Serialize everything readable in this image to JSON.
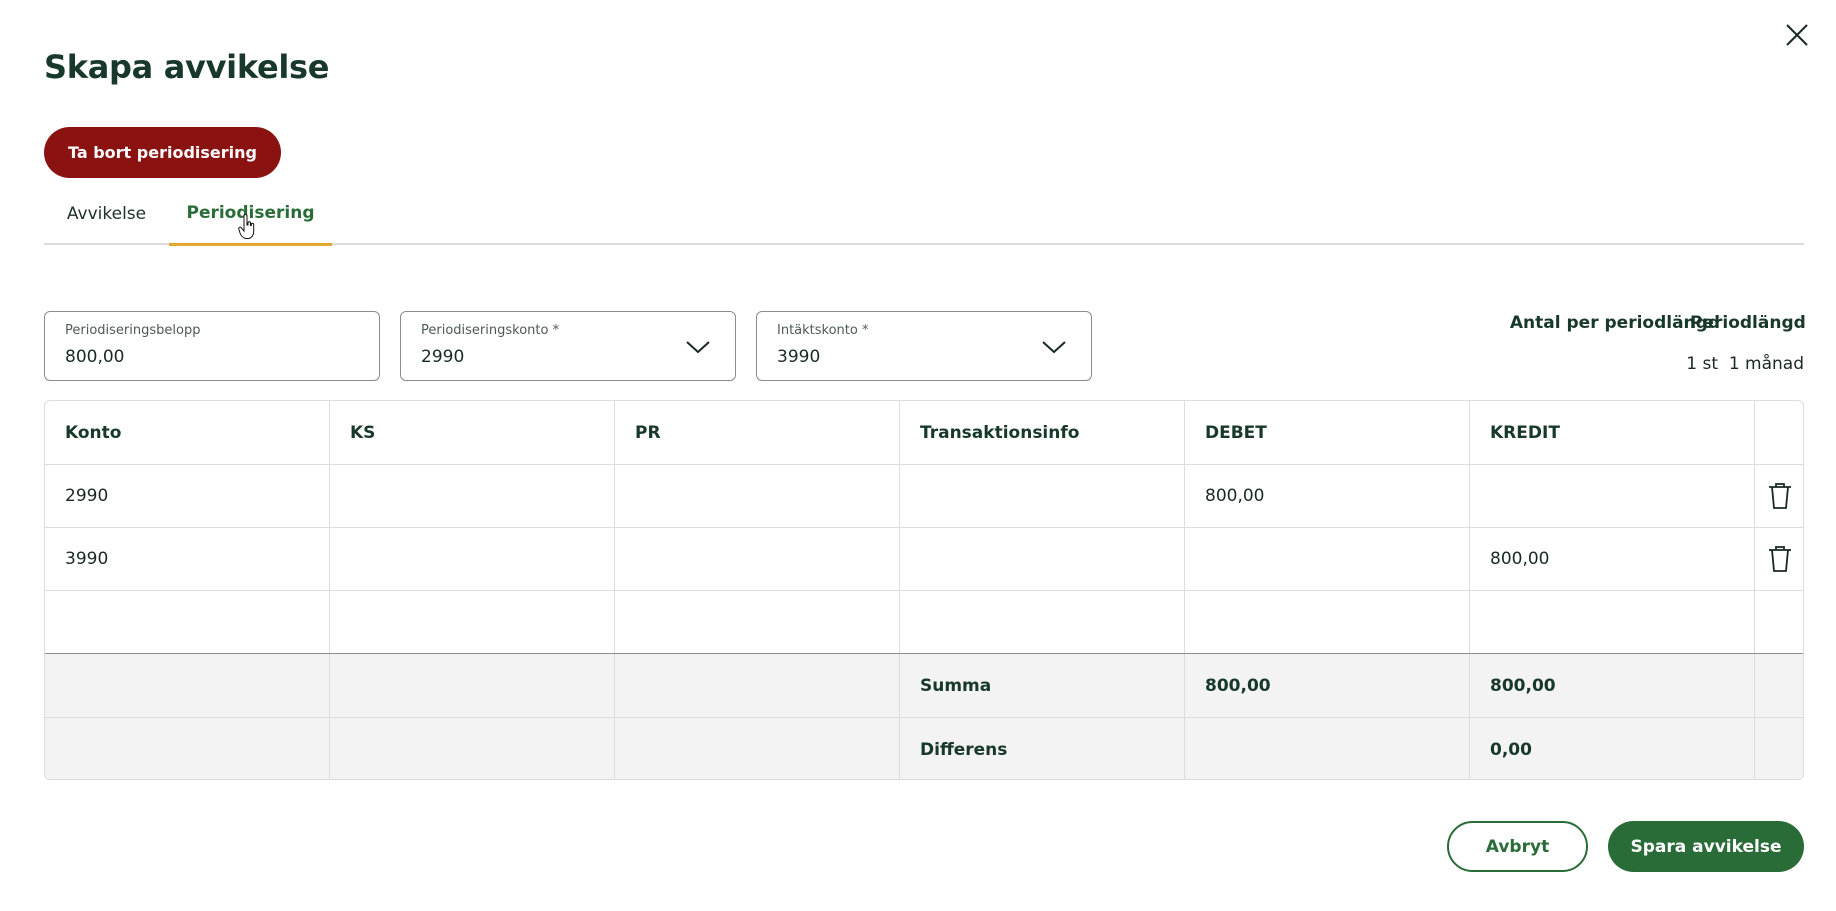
{
  "dialog": {
    "title": "Skapa avvikelse",
    "remove_label": "Ta bort periodisering"
  },
  "tabs": [
    {
      "label": "Avvikelse",
      "active": false
    },
    {
      "label": "Periodisering",
      "active": true
    }
  ],
  "fields": {
    "amount": {
      "label": "Periodiseringsbelopp",
      "value": "800,00"
    },
    "accrual_account": {
      "label": "Periodiseringskonto *",
      "value": "2990"
    },
    "income_account": {
      "label": "Intäktskonto *",
      "value": "3990"
    }
  },
  "period": {
    "count_header": "Antal per periodlängd",
    "count_value": "1 st",
    "length_header": "Periodlängd",
    "length_value": "1 månad"
  },
  "table": {
    "columns": [
      "Konto",
      "KS",
      "PR",
      "Transaktionsinfo",
      "DEBET",
      "KREDIT"
    ],
    "rows": [
      {
        "konto": "2990",
        "ks": "",
        "pr": "",
        "info": "",
        "debet": "800,00",
        "kredit": ""
      },
      {
        "konto": "3990",
        "ks": "",
        "pr": "",
        "info": "",
        "debet": "",
        "kredit": "800,00"
      }
    ],
    "sum": {
      "label": "Summa",
      "debet": "800,00",
      "kredit": "800,00"
    },
    "diff": {
      "label": "Differens",
      "debet": "",
      "kredit": "0,00"
    }
  },
  "footer": {
    "cancel_label": "Avbryt",
    "save_label": "Spara avvikelse"
  },
  "colors": {
    "primary_green": "#2a6c38",
    "danger_red": "#8a1210",
    "tab_underline": "#e3a72f",
    "heading": "#17382b"
  },
  "icons": {
    "close": "close-icon",
    "dropdown": "chevron-down-icon",
    "delete": "trash-icon"
  }
}
